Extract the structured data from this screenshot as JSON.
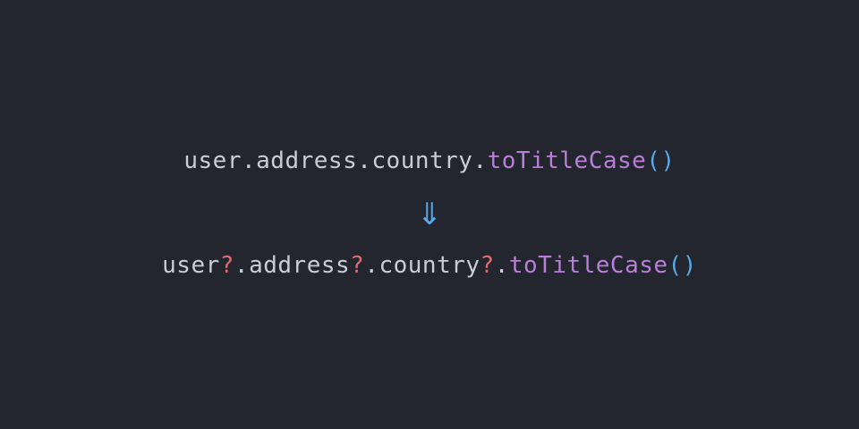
{
  "colors": {
    "background": "#23262e",
    "identifier": "#c9cdd6",
    "method": "#b97fd6",
    "paren": "#5aa7e6",
    "optional_operator": "#e26a6f",
    "arrow": "#5aa7e6"
  },
  "original": {
    "ident_1": "user",
    "dot_1": ".",
    "ident_2": "address",
    "dot_2": ".",
    "ident_3": "country",
    "dot_3": ".",
    "method": "toTitleCase",
    "paren_open": "(",
    "paren_close": ")"
  },
  "arrow": {
    "glyph": "⇓",
    "icon": "double-down-arrow-icon"
  },
  "optional": {
    "ident_1": "user",
    "qm_1": "?",
    "dot_1": ".",
    "ident_2": "address",
    "qm_2": "?",
    "dot_2": ".",
    "ident_3": "country",
    "qm_3": "?",
    "dot_3": ".",
    "method": "toTitleCase",
    "paren_open": "(",
    "paren_close": ")"
  }
}
